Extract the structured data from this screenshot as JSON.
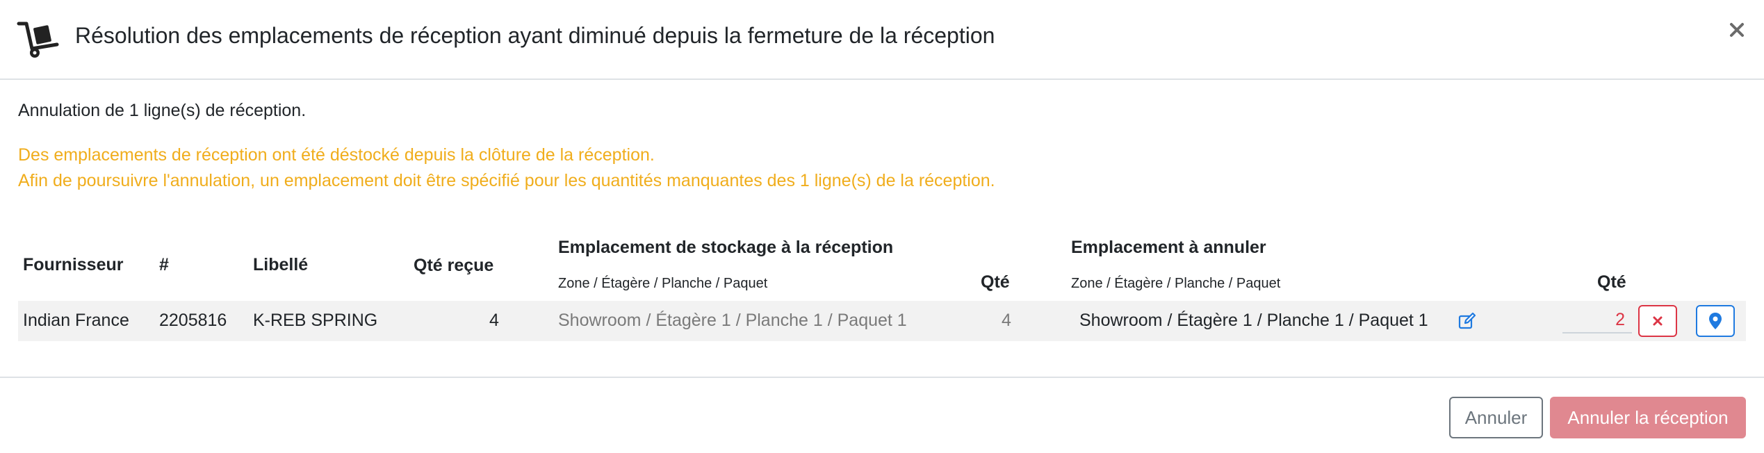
{
  "header": {
    "title": "Résolution des emplacements de réception ayant diminué depuis la fermeture de la réception",
    "icon": "dolly-cart-icon",
    "close_icon": "close-icon"
  },
  "body": {
    "info": "Annulation de 1 ligne(s) de réception.",
    "warning_line1": "Des emplacements de réception ont été déstocké depuis la clôture de la réception.",
    "warning_line2": "Afin de poursuivre l'annulation, un emplacement doit être spécifié pour les quantités manquantes des 1 ligne(s) de la réception."
  },
  "table": {
    "headers": {
      "fournisseur": "Fournisseur",
      "numero": "#",
      "libelle": "Libellé",
      "qte_recue": "Qté reçue",
      "emplacement_reception": "Emplacement de stockage à la réception",
      "emplacement_reception_sub": "Zone / Étagère / Planche / Paquet",
      "qte_reception": "Qté",
      "emplacement_annuler": "Emplacement à annuler",
      "emplacement_annuler_sub": "Zone / Étagère / Planche / Paquet",
      "qte_annuler": "Qté"
    },
    "rows": [
      {
        "fournisseur": "Indian France",
        "numero": "2205816",
        "libelle": "K-REB SPRING",
        "qte_recue": "4",
        "emplacement_reception": "Showroom / Étagère 1 / Planche 1 / Paquet 1",
        "qte_reception": "4",
        "emplacement_annuler": "Showroom / Étagère 1 / Planche 1 / Paquet 1",
        "qte_annuler": "2"
      }
    ]
  },
  "footer": {
    "cancel_label": "Annuler",
    "confirm_label": "Annuler la réception"
  },
  "colors": {
    "warning": "#f0ad1c",
    "danger": "#dc3545",
    "primary": "#1f7ae0",
    "confirm_disabled": "#e08890"
  }
}
